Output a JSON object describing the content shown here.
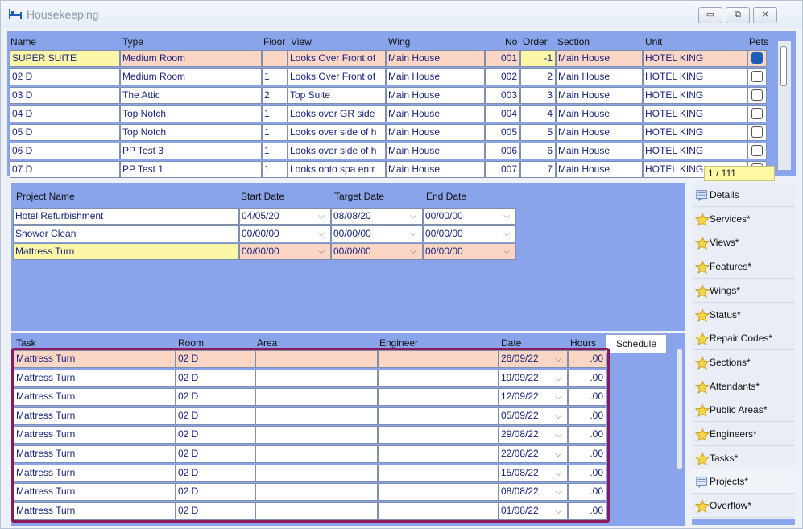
{
  "window": {
    "title": "Housekeeping",
    "min": "▭",
    "max": "⧉",
    "close": "⨯"
  },
  "rooms": {
    "headers": {
      "name": "Name",
      "type": "Type",
      "floor": "Floor",
      "view": "View",
      "wing": "Wing",
      "no": "No",
      "order": "Order",
      "section": "Section",
      "unit": "Unit",
      "pets": "Pets"
    },
    "rows": [
      {
        "name": "SUPER SUITE",
        "type": "Medium Room",
        "floor": "",
        "view": "Looks Over Front of",
        "wing": "Main House",
        "no": "001",
        "order": "-1",
        "section": "Main House",
        "unit": "HOTEL KING",
        "pets": true
      },
      {
        "name": "02 D",
        "type": "Medium Room",
        "floor": "1",
        "view": "Looks Over Front of",
        "wing": "Main House",
        "no": "002",
        "order": "2",
        "section": "Main House",
        "unit": "HOTEL KING",
        "pets": false
      },
      {
        "name": "03 D",
        "type": "The Attic",
        "floor": "2",
        "view": "Top Suite",
        "wing": "Main House",
        "no": "003",
        "order": "3",
        "section": "Main House",
        "unit": "HOTEL KING",
        "pets": false
      },
      {
        "name": "04 D",
        "type": "Top Notch",
        "floor": "1",
        "view": "Looks over GR side",
        "wing": "Main House",
        "no": "004",
        "order": "4",
        "section": "Main House",
        "unit": "HOTEL KING",
        "pets": false
      },
      {
        "name": "05 D",
        "type": "Top Notch",
        "floor": "1",
        "view": "Looks over side of h",
        "wing": "Main House",
        "no": "005",
        "order": "5",
        "section": "Main House",
        "unit": "HOTEL KING",
        "pets": false
      },
      {
        "name": "06 D",
        "type": "PP Test 3",
        "floor": "1",
        "view": "Looks over side of h",
        "wing": "Main House",
        "no": "006",
        "order": "6",
        "section": "Main House",
        "unit": "HOTEL KING",
        "pets": false
      },
      {
        "name": "07 D",
        "type": "PP Test 1",
        "floor": "1",
        "view": "Looks onto spa entr",
        "wing": "Main House",
        "no": "007",
        "order": "7",
        "section": "Main House",
        "unit": "HOTEL KING",
        "pets": false
      }
    ],
    "record_counter": "1 / 111"
  },
  "projects": {
    "headers": {
      "name": "Project Name",
      "start": "Start Date",
      "target": "Target Date",
      "end": "End Date"
    },
    "rows": [
      {
        "name": "Hotel Refurbishment",
        "start": "04/05/20",
        "target": "08/08/20",
        "end": "00/00/00"
      },
      {
        "name": "Shower Clean",
        "start": "00/00/00",
        "target": "00/00/00",
        "end": "00/00/00"
      },
      {
        "name": "Mattress Turn",
        "start": "00/00/00",
        "target": "00/00/00",
        "end": "00/00/00"
      }
    ]
  },
  "tasks": {
    "headers": {
      "task": "Task",
      "room": "Room",
      "area": "Area",
      "engineer": "Engineer",
      "date": "Date",
      "hours": "Hours"
    },
    "schedule_label": "Schedule",
    "rows": [
      {
        "task": "Mattress Turn",
        "room": "02 D",
        "area": "",
        "engineer": "",
        "date": "26/09/22",
        "hours": ".00"
      },
      {
        "task": "Mattress Turn",
        "room": "02 D",
        "area": "",
        "engineer": "",
        "date": "19/09/22",
        "hours": ".00"
      },
      {
        "task": "Mattress Turn",
        "room": "02 D",
        "area": "",
        "engineer": "",
        "date": "12/09/22",
        "hours": ".00"
      },
      {
        "task": "Mattress Turn",
        "room": "02 D",
        "area": "",
        "engineer": "",
        "date": "05/09/22",
        "hours": ".00"
      },
      {
        "task": "Mattress Turn",
        "room": "02 D",
        "area": "",
        "engineer": "",
        "date": "29/08/22",
        "hours": ".00"
      },
      {
        "task": "Mattress Turn",
        "room": "02 D",
        "area": "",
        "engineer": "",
        "date": "22/08/22",
        "hours": ".00"
      },
      {
        "task": "Mattress Turn",
        "room": "02 D",
        "area": "",
        "engineer": "",
        "date": "15/08/22",
        "hours": ".00"
      },
      {
        "task": "Mattress Turn",
        "room": "02 D",
        "area": "",
        "engineer": "",
        "date": "08/08/22",
        "hours": ".00"
      },
      {
        "task": "Mattress Turn",
        "room": "02 D",
        "area": "",
        "engineer": "",
        "date": "01/08/22",
        "hours": ".00"
      }
    ]
  },
  "side_tabs": [
    {
      "label": "Details",
      "icon": "details-icon"
    },
    {
      "label": "Services*",
      "icon": "star-icon"
    },
    {
      "label": "Views*",
      "icon": "star-icon"
    },
    {
      "label": "Features*",
      "icon": "star-icon"
    },
    {
      "label": "Wings*",
      "icon": "star-icon"
    },
    {
      "label": "Status*",
      "icon": "star-icon"
    },
    {
      "label": "Repair Codes*",
      "icon": "star-icon"
    },
    {
      "label": "Sections*",
      "icon": "star-icon"
    },
    {
      "label": "Attendants*",
      "icon": "star-icon"
    },
    {
      "label": "Public Areas*",
      "icon": "star-icon"
    },
    {
      "label": "Engineers*",
      "icon": "star-icon"
    },
    {
      "label": "Tasks*",
      "icon": "star-icon"
    },
    {
      "label": "Projects*",
      "icon": "projects-icon"
    },
    {
      "label": "Overflow*",
      "icon": "star-icon"
    }
  ],
  "colors": {
    "panel": "#8aa4ec",
    "selected_row": "#fbd6c4",
    "current_cell": "#fcf7a6",
    "highlight_border": "#8b1a5c",
    "cell_text": "#1a237e"
  }
}
